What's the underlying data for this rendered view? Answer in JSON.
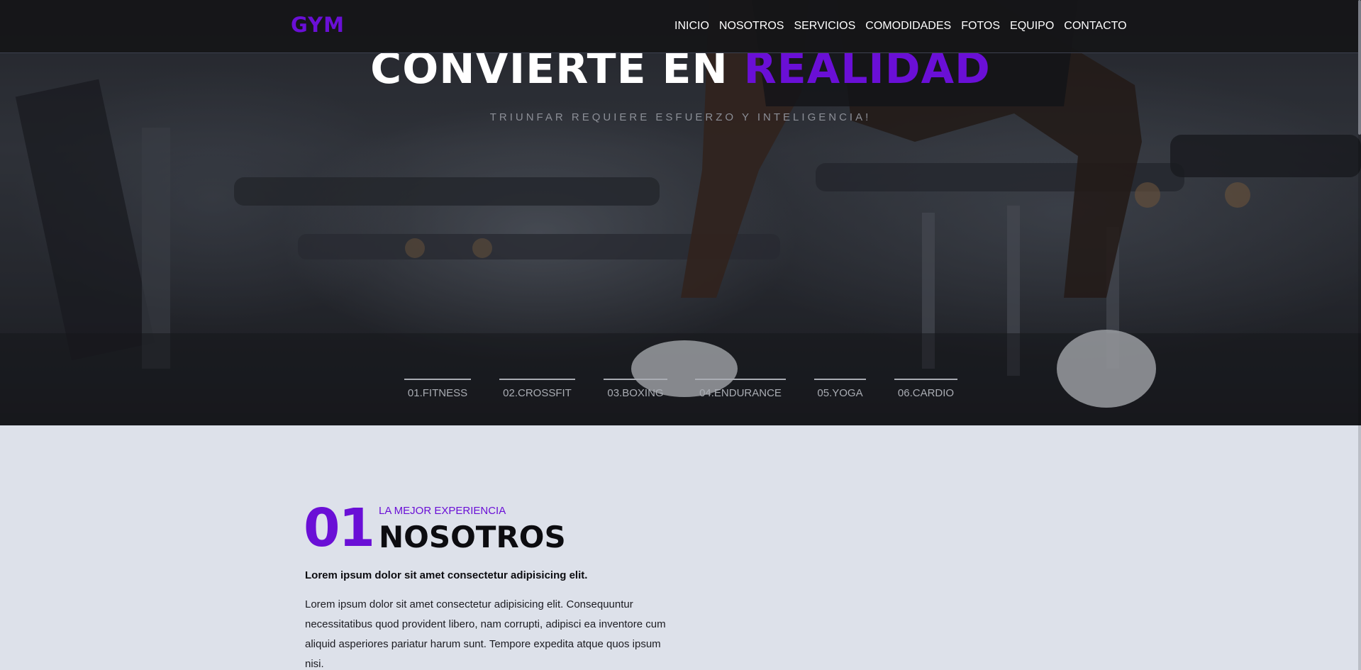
{
  "brand": {
    "logo": "GYM",
    "accent_color": "#6a0fd6"
  },
  "nav": {
    "items": [
      {
        "label": "INICIO"
      },
      {
        "label": "NOSOTROS"
      },
      {
        "label": "SERVICIOS"
      },
      {
        "label": "COMODIDADES"
      },
      {
        "label": "FOTOS"
      },
      {
        "label": "EQUIPO"
      },
      {
        "label": "CONTACTO"
      }
    ]
  },
  "hero": {
    "title_main": "CONVIERTE EN ",
    "title_accent": "REALIDAD",
    "subtitle": "TRIUNFAR REQUIERE ESFUERZO Y INTELIGENCIA!",
    "services": [
      {
        "label": "01.FITNESS"
      },
      {
        "label": "02.CROSSFIT"
      },
      {
        "label": "03.BOXING"
      },
      {
        "label": "04.ENDURANCE"
      },
      {
        "label": "05.YOGA"
      },
      {
        "label": "06.CARDIO"
      }
    ]
  },
  "about": {
    "number": "01",
    "kicker": "LA MEJOR EXPERIENCIA",
    "title": "NOSOTROS",
    "lead": "Lorem ipsum dolor sit amet consectetur adipisicing elit.",
    "body": "Lorem ipsum dolor sit amet consectetur adipisicing elit. Consequuntur necessitatibus quod provident libero, nam corrupti, adipisci ea inventore cum aliquid asperiores pariatur harum sunt. Tempore expedita atque quos ipsum nisi."
  }
}
